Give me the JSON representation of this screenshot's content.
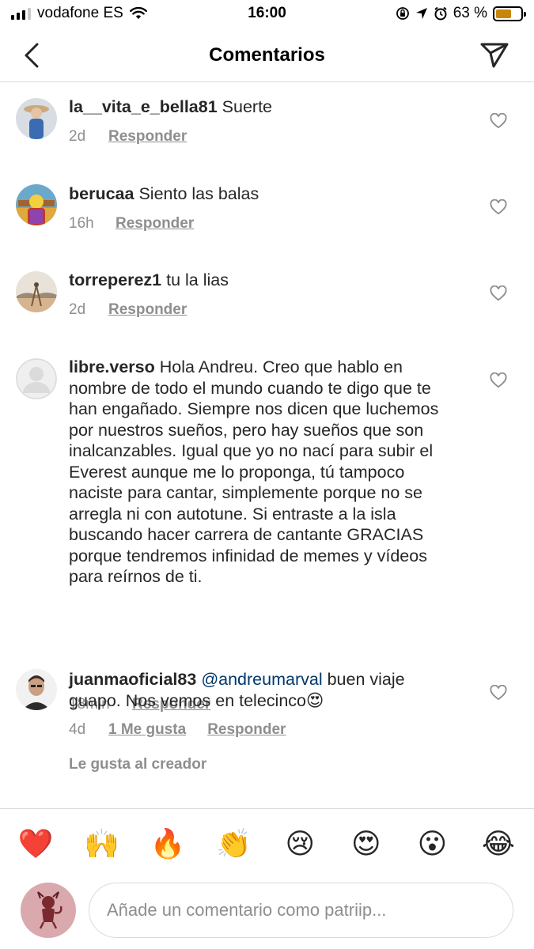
{
  "status_bar": {
    "carrier": "vodafone ES",
    "time": "16:00",
    "battery_percent": "63 %",
    "battery_level": 0.63
  },
  "header": {
    "title": "Comentarios",
    "back_icon": "chevron-left-icon",
    "send_icon": "paper-plane-icon"
  },
  "comments": [
    {
      "username": "la__vita_e_bella81",
      "text": "Suerte",
      "time": "2d",
      "reply": "Responder"
    },
    {
      "username": "berucaa",
      "text": "Siento las balas",
      "time": "16h",
      "reply": "Responder"
    },
    {
      "username": "torreperez1",
      "text": "tu la lias",
      "time": "2d",
      "reply": "Responder"
    },
    {
      "username": "libre.verso",
      "text": "Hola Andreu. Creo que hablo en nombre de todo el mundo cuando te digo que te han engañado. Siempre nos dicen que luchemos por nuestros sueños, pero hay sueños que son inalcanzables. Igual que yo no nací para subir el Everest aunque me lo proponga, tú tampoco naciste para cantar, simplemente porque no se arregla ni con autotune. Si entraste a la isla buscando hacer carrera de cantante GRACIAS porque tendremos infinidad de memes y vídeos para reírnos de ti.",
      "time": "18min",
      "reply": "Responder"
    },
    {
      "username": "juanmaoficial83",
      "mention": "@andreumarval",
      "text": "buen viaje guapo. Nos vemos en telecinco😍",
      "time": "4d",
      "likes": "1 Me gusta",
      "reply": "Responder",
      "creator_like": "Le gusta al creador"
    }
  ],
  "emoji_bar": [
    "❤️",
    "🙌",
    "🔥",
    "👏",
    "😢",
    "😍",
    "😮",
    "😂"
  ],
  "composer": {
    "placeholder": "Añade un comentario como patriip..."
  },
  "colors": {
    "text": "#262626",
    "muted": "#8e8e8e",
    "mention": "#00376b",
    "divider": "#dbdbdb",
    "battery": "#c7860e"
  }
}
